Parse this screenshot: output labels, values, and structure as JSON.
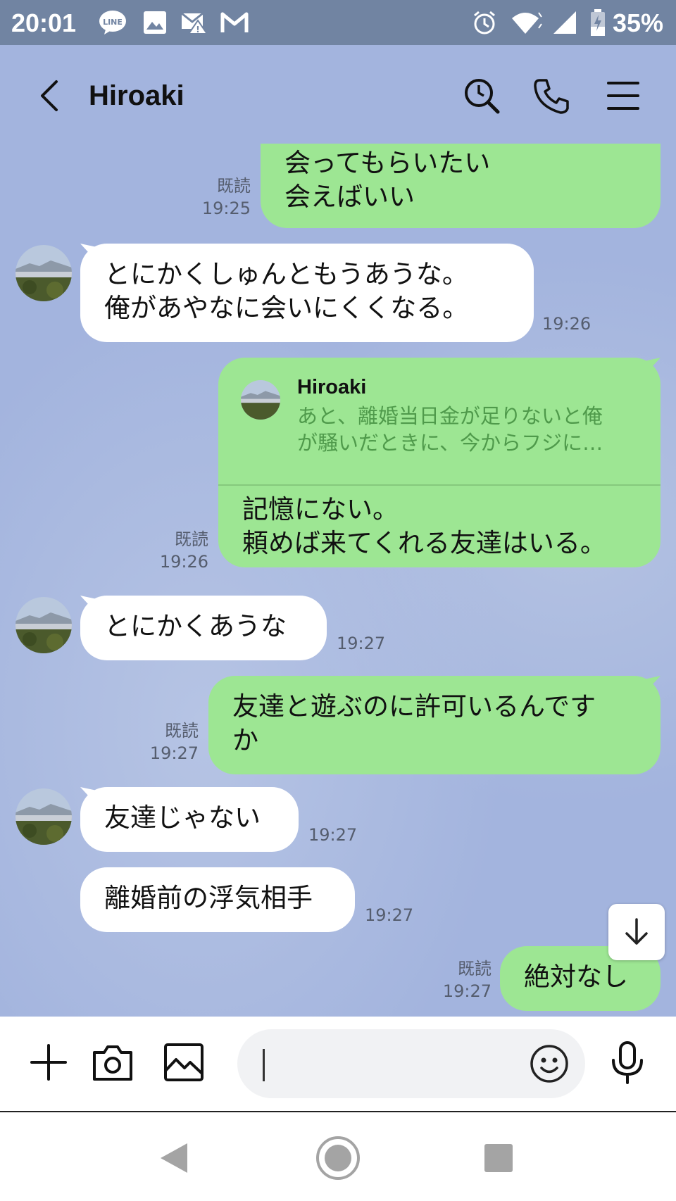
{
  "status_bar": {
    "time": "20:01",
    "battery_percent": "35%"
  },
  "header": {
    "contact_name": "Hiroaki"
  },
  "colors": {
    "chat_background": "#a3b4de",
    "outgoing_bubble": "#9de693",
    "incoming_bubble": "#ffffff",
    "status_bar": "#7184a2"
  },
  "messages": [
    {
      "dir": "out",
      "lines": [
        "会ってもらいたい",
        "会えばいい"
      ],
      "read": "既読",
      "time": "19:25"
    },
    {
      "dir": "in",
      "lines": [
        "とにかくしゅんともうあうな。",
        "俺があやなに会いにくくなる。"
      ],
      "time": "19:26"
    },
    {
      "dir": "out",
      "quote": {
        "name": "Hiroaki",
        "lines": [
          "あと、離婚当日金が足りないと俺",
          "が騒いだときに、今からフジに…"
        ]
      },
      "lines": [
        "記憶にない。",
        "頼めば来てくれる友達はいる。"
      ],
      "read": "既読",
      "time": "19:26"
    },
    {
      "dir": "in",
      "lines": [
        "とにかくあうな"
      ],
      "time": "19:27"
    },
    {
      "dir": "out",
      "lines": [
        "友達と遊ぶのに許可いるんです",
        "か"
      ],
      "read": "既読",
      "time": "19:27"
    },
    {
      "dir": "in",
      "lines": [
        "友達じゃない"
      ],
      "time": "19:27"
    },
    {
      "dir": "in",
      "lines": [
        "離婚前の浮気相手"
      ],
      "time": "19:27"
    },
    {
      "dir": "out",
      "lines": [
        "絶対なし"
      ],
      "read": "既読",
      "time": "19:27"
    }
  ]
}
